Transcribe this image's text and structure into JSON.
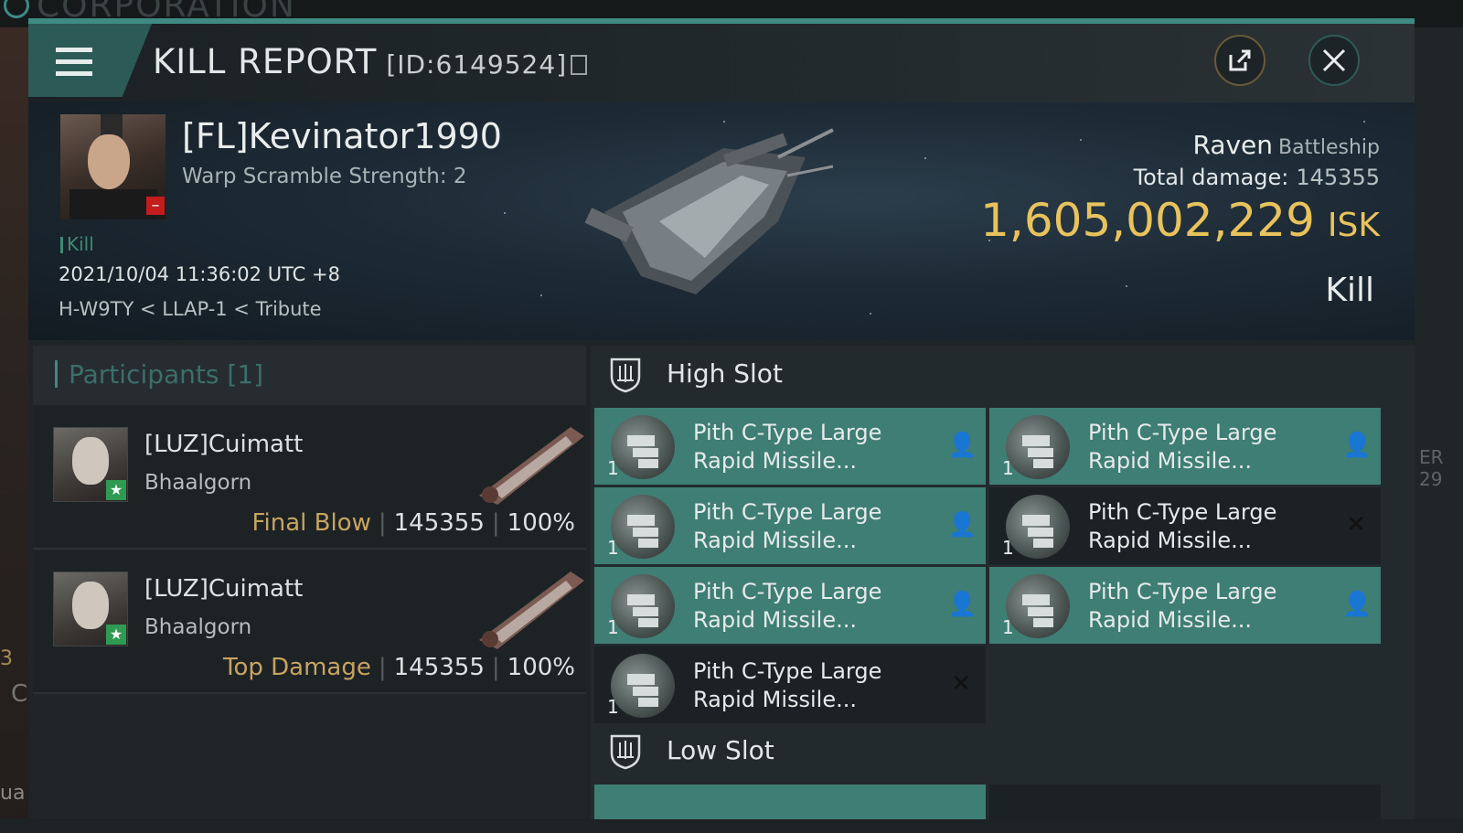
{
  "background": {
    "ghost_title": "CORPORATION",
    "left_fragment": "ua",
    "left_fragment2": "C",
    "left_fragment3": "3",
    "right_fragment": "ER\n29"
  },
  "titlebar": {
    "title": "KILL REPORT",
    "id": "[ID:6149524]",
    "menu_icon": "hamburger-menu-icon",
    "share_icon": "external-share-icon",
    "close_icon": "close-icon"
  },
  "victim": {
    "name": "[FL]Kevinator1990",
    "warp_scramble": "Warp Scramble Strength: 2",
    "tag": "Kill",
    "datetime": "2021/10/04 11:36:02 UTC +8",
    "location": "H-W9TY < LLAP-1 < Tribute",
    "ship": "Raven",
    "ship_class": "Battleship",
    "total_damage_label": "Total damage:",
    "total_damage": "145355",
    "isk_value": "1,605,002,229",
    "isk_unit": "ISK",
    "result": "Kill"
  },
  "participants": {
    "title": "Participants",
    "count": "[1]",
    "rows": [
      {
        "pilot": "[LUZ]Cuimatt",
        "ship": "Bhaalgorn",
        "role": "Final Blow",
        "damage": "145355",
        "percent": "100%"
      },
      {
        "pilot": "[LUZ]Cuimatt",
        "ship": "Bhaalgorn",
        "role": "Top Damage",
        "damage": "145355",
        "percent": "100%"
      }
    ]
  },
  "fitting": {
    "high_slot_title": "High Slot",
    "low_slot_title": "Low Slot",
    "modules": [
      {
        "qty": "1",
        "name_line1": "Pith C-Type Large",
        "name_line2": "Rapid Missile...",
        "state": "on"
      },
      {
        "qty": "1",
        "name_line1": "Pith C-Type Large",
        "name_line2": "Rapid Missile...",
        "state": "on"
      },
      {
        "qty": "1",
        "name_line1": "Pith C-Type Large",
        "name_line2": "Rapid Missile...",
        "state": "on"
      },
      {
        "qty": "1",
        "name_line1": "Pith C-Type Large",
        "name_line2": "Rapid Missile...",
        "state": "off"
      },
      {
        "qty": "1",
        "name_line1": "Pith C-Type Large",
        "name_line2": "Rapid Missile...",
        "state": "on"
      },
      {
        "qty": "1",
        "name_line1": "Pith C-Type Large",
        "name_line2": "Rapid Missile...",
        "state": "on"
      },
      {
        "qty": "1",
        "name_line1": "Pith C-Type Large",
        "name_line2": "Rapid Missile...",
        "state": "off"
      }
    ],
    "status_glyph_on": "👤",
    "status_glyph_off": "✕"
  },
  "colors": {
    "accent_teal": "#3f8a82",
    "module_active": "#3f7e74",
    "isk_gold": "#e8c35c",
    "role_gold": "#c7a460"
  }
}
